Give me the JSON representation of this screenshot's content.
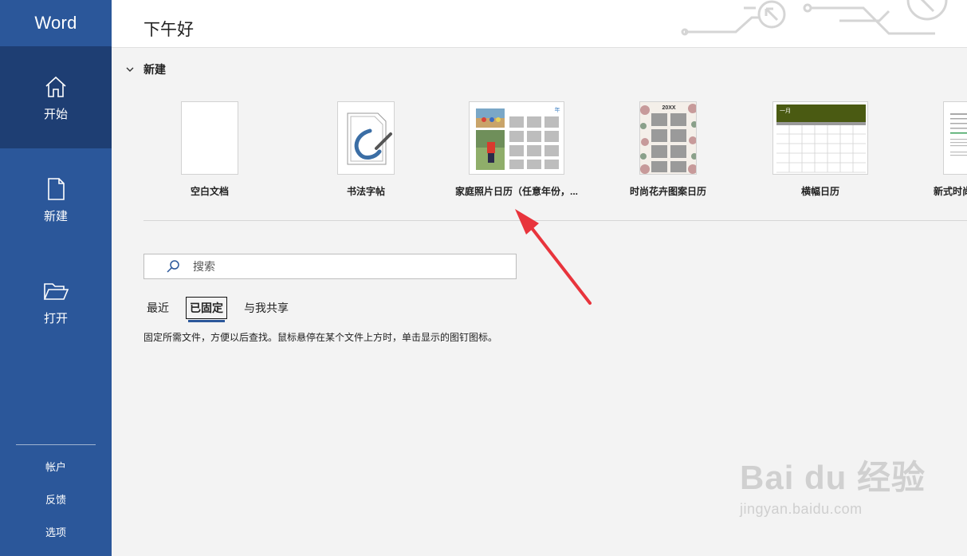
{
  "app": {
    "title": "Word",
    "greeting": "下午好"
  },
  "sidebar": {
    "items": [
      {
        "label": "开始",
        "icon": "home-icon"
      },
      {
        "label": "新建",
        "icon": "new-document-icon"
      },
      {
        "label": "打开",
        "icon": "open-folder-icon"
      }
    ],
    "bottom": [
      "帐户",
      "反馈",
      "选项"
    ]
  },
  "new_section": {
    "title": "新建",
    "templates": [
      {
        "label": "空白文档"
      },
      {
        "label": "书法字帖"
      },
      {
        "label": "家庭照片日历（任意年份，..."
      },
      {
        "label": "时尚花卉图案日历",
        "thumb_text": "20XX"
      },
      {
        "label": "横幅日历",
        "thumb_text": "一月"
      },
      {
        "label": "新式时尚"
      }
    ]
  },
  "search": {
    "placeholder": "搜索"
  },
  "tabs": [
    "最近",
    "已固定",
    "与我共享"
  ],
  "pinned_hint": "固定所需文件，方便以后查找。鼠标悬停在某个文件上方时，单击显示的图钉图标。",
  "watermark": {
    "main": "Bai du 经验",
    "sub": "jingyan.baidu.com"
  },
  "colors": {
    "sidebar": "#2b579a",
    "sidebar_active": "#1e3e73",
    "annotation_arrow": "#e8343c"
  }
}
